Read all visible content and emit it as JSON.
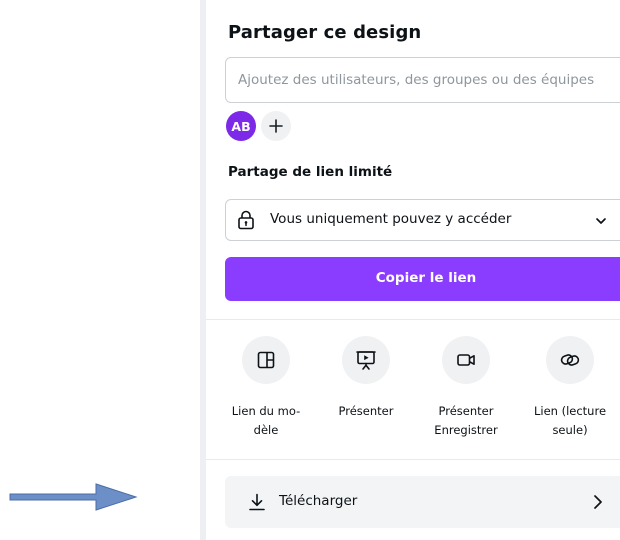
{
  "share_panel": {
    "title": "Partager ce design",
    "search": {
      "placeholder": "Ajoutez des utilisateurs, des groupes ou des équipes",
      "value": ""
    },
    "people": [
      {
        "initials": "AB",
        "color": "#7d2ae8"
      }
    ],
    "add_people_icon": "plus-icon",
    "link_sharing": {
      "label": "Partage de lien limité",
      "access_icon": "lock-icon",
      "access_value": "Vous uniquement pouvez y accéder",
      "dropdown_icon": "chevron-down-icon"
    },
    "copy_link_label": "Copier le lien",
    "accent_color": "#8b3dff",
    "actions": [
      {
        "icon": "template-layout-icon",
        "line1": "Lien du mo-",
        "line2": "dèle"
      },
      {
        "icon": "present-icon",
        "line1": "Présenter",
        "line2": ""
      },
      {
        "icon": "video-camera-icon",
        "line1": "Présenter",
        "line2": "Enregistrer"
      },
      {
        "icon": "link-icon",
        "line1": "Lien (lecture",
        "line2": "seule)"
      }
    ],
    "download": {
      "icon": "download-icon",
      "label": "Télécharger",
      "arrow_icon": "chevron-right-icon"
    }
  },
  "annotation": {
    "arrow_color": "#6d8fc8"
  }
}
